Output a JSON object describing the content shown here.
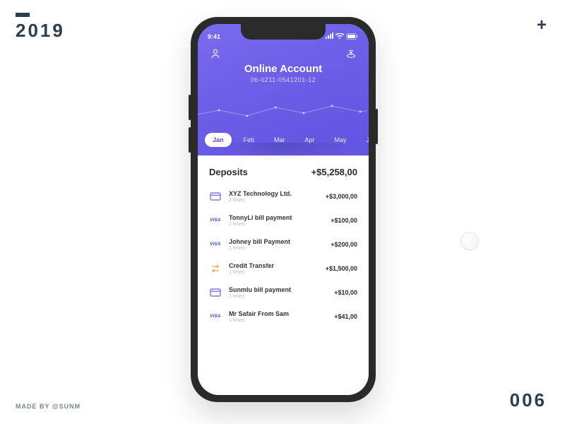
{
  "decor": {
    "year": "2019",
    "plus": "+",
    "credit": "MADE BY @SUNM",
    "page_num": "006"
  },
  "status": {
    "time": "9:41"
  },
  "header": {
    "title": "Online Account",
    "account_number": "06-0211-0541201-12"
  },
  "months": [
    {
      "label": "Jan",
      "active": true
    },
    {
      "label": "Feb",
      "active": false
    },
    {
      "label": "Mar",
      "active": false
    },
    {
      "label": "Apr",
      "active": false
    },
    {
      "label": "May",
      "active": false
    },
    {
      "label": "Ju",
      "active": false
    }
  ],
  "deposits": {
    "heading": "Deposits",
    "total": "+$5,258,00",
    "items": [
      {
        "icon": "card",
        "title": "XYZ Technology Ltd.",
        "subtitle": "2 times",
        "amount": "+$3,000,00"
      },
      {
        "icon": "visa",
        "title": "TonnyLi bill payment",
        "subtitle": "2 times",
        "amount": "+$100,00"
      },
      {
        "icon": "visa",
        "title": "Johney bill Payment",
        "subtitle": "1 times",
        "amount": "+$200,00"
      },
      {
        "icon": "transfer",
        "title": "Credit Transfer",
        "subtitle": "1 times",
        "amount": "+$1,500,00"
      },
      {
        "icon": "card",
        "title": "Sunmlu bill payment",
        "subtitle": "1 times",
        "amount": "+$10,00"
      },
      {
        "icon": "visa",
        "title": "Mr Safair From Sam",
        "subtitle": "1 times",
        "amount": "+$41,00"
      }
    ]
  }
}
